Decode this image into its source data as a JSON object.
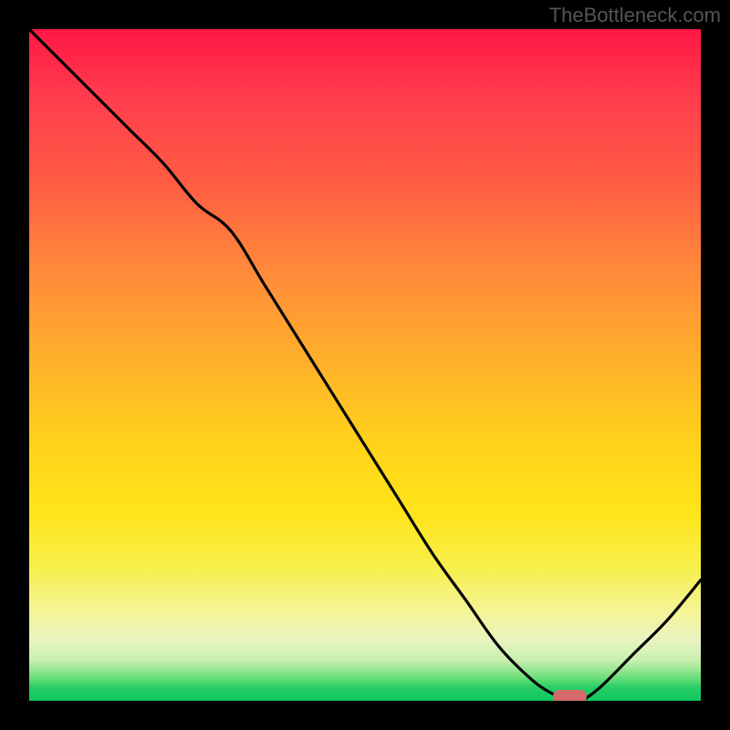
{
  "watermark": "TheBottleneck.com",
  "chart_data": {
    "type": "line",
    "title": "",
    "xlabel": "",
    "ylabel": "",
    "xlim": [
      0,
      100
    ],
    "ylim": [
      0,
      100
    ],
    "x": [
      0,
      5,
      10,
      15,
      20,
      25,
      30,
      35,
      40,
      45,
      50,
      55,
      60,
      65,
      70,
      75,
      78,
      80,
      82,
      85,
      90,
      95,
      100
    ],
    "y": [
      100,
      95,
      90,
      85,
      80,
      74,
      70,
      62,
      54,
      46,
      38,
      30,
      22,
      15,
      8,
      3,
      1,
      0,
      0,
      2,
      7,
      12,
      18
    ],
    "marker": {
      "x_start": 78,
      "x_end": 83,
      "y": 0
    },
    "background_gradient": {
      "top": "#ff1744",
      "mid": "#ffd31a",
      "bottom": "#10c55e"
    }
  }
}
